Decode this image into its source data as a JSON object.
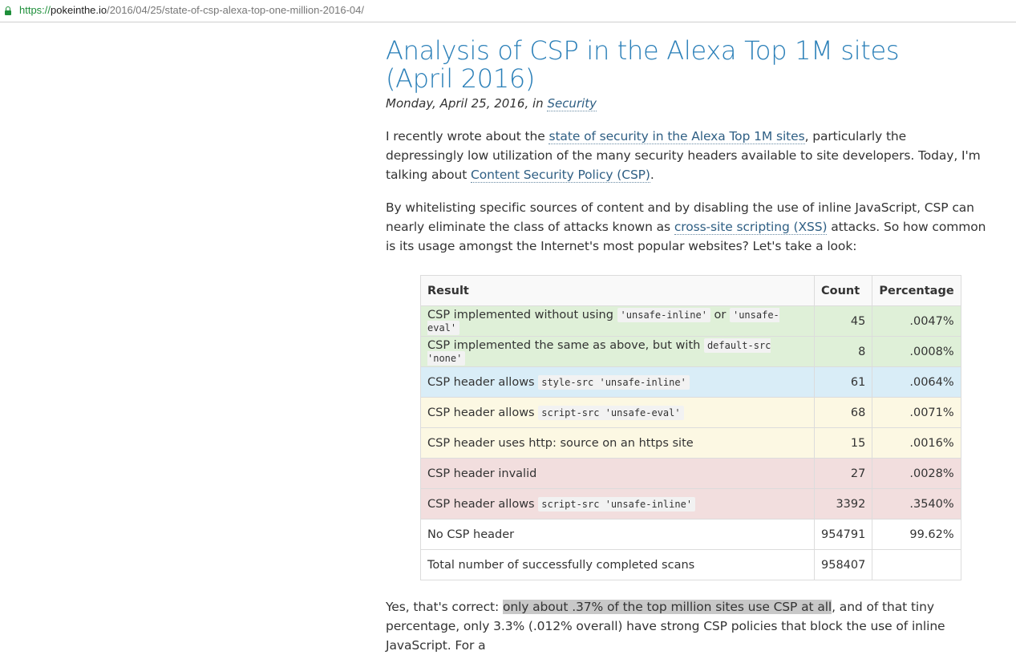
{
  "browser": {
    "url_scheme": "https://",
    "url_host": "pokeinthe.io",
    "url_path": "/2016/04/25/state-of-csp-alexa-top-one-million-2016-04/"
  },
  "article": {
    "title": "Analysis of CSP in the Alexa Top 1M sites (April 2016)",
    "date": "Monday, April 25, 2016, in",
    "category": "Security",
    "p1_before": "I recently wrote about the ",
    "p1_link1": "state of security in the Alexa Top 1M sites",
    "p1_mid": ", particularly the depressingly low utilization of the many security headers available to site developers. Today, I'm talking about ",
    "p1_link2": "Content Security Policy (CSP)",
    "p1_end": ".",
    "p2_before": "By whitelisting specific sources of content and by disabling the use of inline JavaScript, CSP can nearly eliminate the class of attacks known as ",
    "p2_link": "cross-site scripting (XSS)",
    "p2_after": " attacks. So how common is its usage amongst the Internet's most popular websites? Let's take a look:",
    "p3_before": "Yes, that's correct: ",
    "p3_highlight": "only about .37% of the top million sites use CSP at all",
    "p3_after": ", and of that tiny percentage, only 3.3% (.012% overall) have strong CSP policies that block the use of inline JavaScript. For a"
  },
  "table": {
    "headers": [
      "Result",
      "Count",
      "Percentage"
    ],
    "rows": [
      {
        "t1": "CSP implemented without using ",
        "c1": "'unsafe-inline'",
        "t2": " or ",
        "c2": "'unsafe-eval'",
        "count": "45",
        "pct": ".0047%"
      },
      {
        "t1": "CSP implemented the same as above, but with ",
        "c1": "default-src 'none'",
        "count": "8",
        "pct": ".0008%"
      },
      {
        "t1": "CSP header allows ",
        "c1": "style-src 'unsafe-inline'",
        "count": "61",
        "pct": ".0064%"
      },
      {
        "t1": "CSP header allows ",
        "c1": "script-src 'unsafe-eval'",
        "count": "68",
        "pct": ".0071%"
      },
      {
        "t1": "CSP header uses http: source on an https site",
        "count": "15",
        "pct": ".0016%"
      },
      {
        "t1": "CSP header invalid",
        "count": "27",
        "pct": ".0028%"
      },
      {
        "t1": "CSP header allows ",
        "c1": "script-src 'unsafe-inline'",
        "count": "3392",
        "pct": ".3540%"
      },
      {
        "t1": "No CSP header",
        "count": "954791",
        "pct": "99.62%"
      },
      {
        "t1": "Total number of successfully completed scans",
        "count": "958407",
        "pct": ""
      }
    ]
  },
  "colors": {
    "link": "#2f5f84",
    "title": "#2a7fb8",
    "row_green": "#dff0d8",
    "row_blue": "#d9edf7",
    "row_yellow": "#fcf8e3",
    "row_red": "#f2dede",
    "secure_lock": "#1e8f3a"
  },
  "icons": {
    "secure": "lock-icon"
  }
}
